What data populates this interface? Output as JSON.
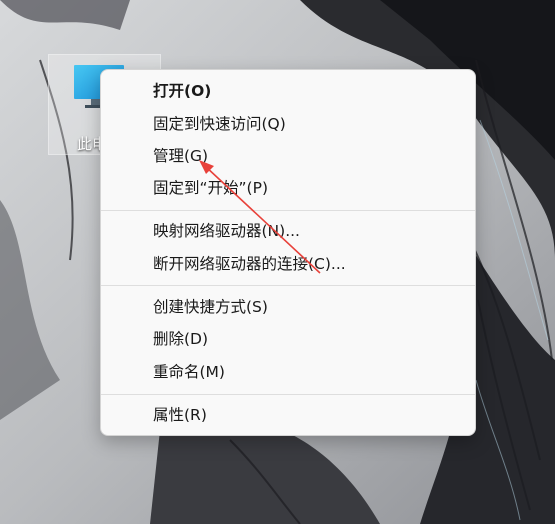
{
  "desktop": {
    "icon_label": "此电脑",
    "icon_label_visible": "此电"
  },
  "context_menu": {
    "groups": [
      [
        {
          "label": "打开(O)",
          "bold": true
        },
        {
          "label": "固定到快速访问(Q)"
        },
        {
          "label": "管理(G)"
        },
        {
          "label": "固定到“开始”(P)"
        }
      ],
      [
        {
          "label": "映射网络驱动器(N)..."
        },
        {
          "label": "断开网络驱动器的连接(C)..."
        }
      ],
      [
        {
          "label": "创建快捷方式(S)"
        },
        {
          "label": "删除(D)"
        },
        {
          "label": "重命名(M)"
        }
      ],
      [
        {
          "label": "属性(R)"
        }
      ]
    ]
  },
  "annotation": {
    "arrow_color": "#e8413a"
  }
}
